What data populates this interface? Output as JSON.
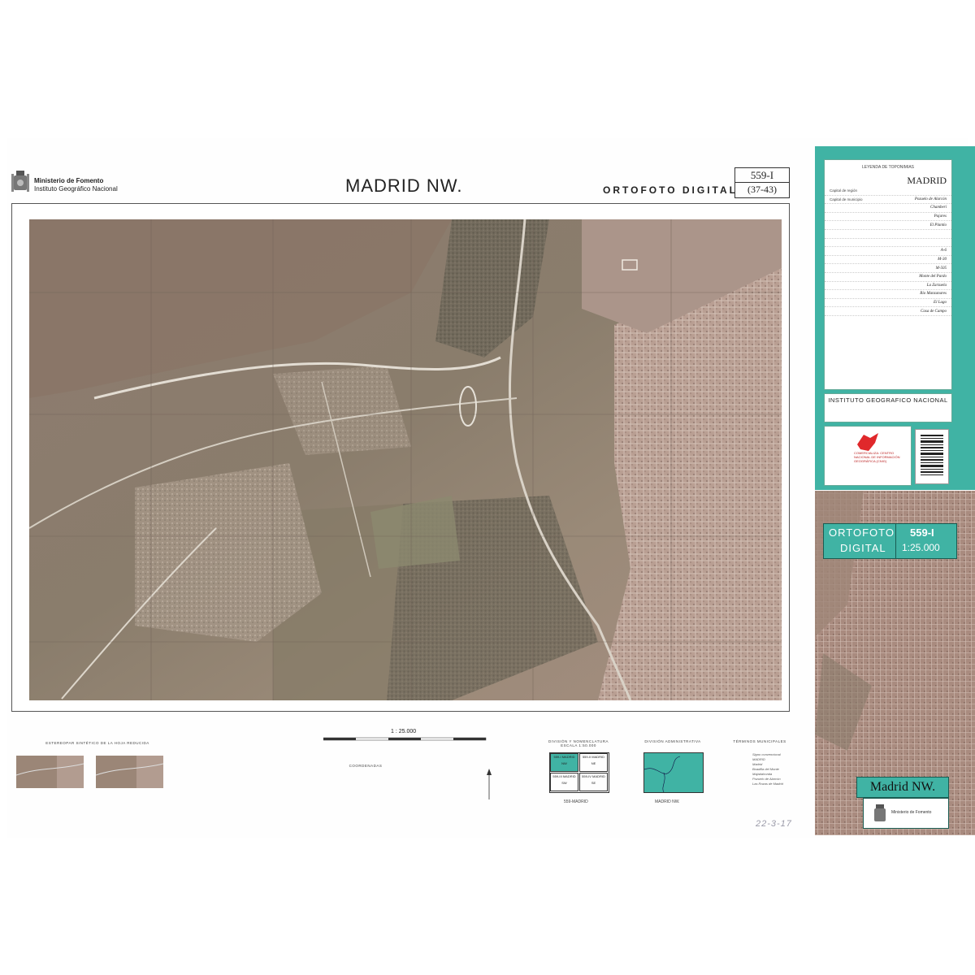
{
  "header": {
    "ministry_line1": "Ministerio de Fomento",
    "ministry_line2": "Instituto Geográfico Nacional",
    "title": "MADRID NW.",
    "subtitle": "ORTOFOTO DIGITAL",
    "sheet_number": "559-I",
    "sheet_grid": "(37-43)"
  },
  "legend": {
    "heading": "LEYENDA DE TOPONIMIAS",
    "place": "MADRID",
    "rows": [
      {
        "label": "Capital de región",
        "value": ""
      },
      {
        "label": "Capital de municipio",
        "value": "Pozuelo de Alarcón"
      },
      {
        "label": "",
        "value": "Chamberí"
      },
      {
        "label": "",
        "value": "Pajares"
      },
      {
        "label": "",
        "value": "El Plantío"
      },
      {
        "label": "",
        "value": ""
      },
      {
        "label": "",
        "value": ""
      },
      {
        "label": "",
        "value": "A-6"
      },
      {
        "label": "",
        "value": "M-30"
      },
      {
        "label": "",
        "value": "M-505"
      },
      {
        "label": "",
        "value": "Monte del Pardo"
      },
      {
        "label": "",
        "value": "La Zarzuela"
      },
      {
        "label": "",
        "value": "Río Manzanares"
      },
      {
        "label": "",
        "value": "El Lago"
      },
      {
        "label": "",
        "value": "Casa de Campo"
      }
    ]
  },
  "institute": {
    "name": "INSTITUTO GEOGRAFICO NACIONAL",
    "cnig": "COMERCIALIZA: CENTRO NACIONAL DE INFORMACIÓN GEOGRÁFICA (CNIG)"
  },
  "cover": {
    "band_left_1": "ORTOFOTO",
    "band_right_1": "559-I",
    "band_left_2": "DIGITAL",
    "band_right_2": "1:25.000",
    "name": "Madrid NW.",
    "logo_text": "Ministerio de Fomento"
  },
  "scale": {
    "label": "1 : 25.000"
  },
  "bottom": {
    "stereo_heading": "ESTEREOPAR SINTÉTICO DE LA HOJA REDUCIDA",
    "division_heading": "DIVISIÓN Y NOMENCLATURA ESCALA 1:50.000",
    "admin_heading": "DIVISIÓN ADMINISTRATIVA",
    "municipios_heading": "TÉRMINOS MUNICIPALES",
    "division_label": "559-MADRID",
    "admin_label": "MADRID NW.",
    "coordinates_heading": "COORDENADAS",
    "grid_cells": [
      "559-I MADRID NW",
      "559-II MADRID NE",
      "559-III MADRID SW",
      "559-IV MADRID SE"
    ],
    "municipios": [
      {
        "code": "",
        "name": "Signo convencional"
      },
      {
        "code": "",
        "name": "MADRID"
      },
      {
        "code": "",
        "name": "Madrid"
      },
      {
        "code": "",
        "name": "Boadilla del Monte"
      },
      {
        "code": "",
        "name": "Majadahonda"
      },
      {
        "code": "",
        "name": "Pozuelo de Alarcón"
      },
      {
        "code": "",
        "name": "Las Rozas de Madrid"
      }
    ],
    "handwritten": "22-3-17"
  },
  "colors": {
    "accent": "#40b3a4",
    "frame": "#555555"
  }
}
